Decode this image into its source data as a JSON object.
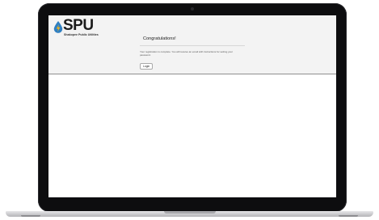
{
  "logo": {
    "wordmark": "SPU",
    "subtitle": "Shakopee Public Utilities",
    "icon": "drop-and-bolt-icon",
    "colors": {
      "drop": "#2f7fc1",
      "bolt": "#f2b21b"
    }
  },
  "card": {
    "title": "Congratulations!",
    "message": "Your registration is complete. You will receive an email with instructions for setting your password.",
    "login_button": "Login"
  }
}
